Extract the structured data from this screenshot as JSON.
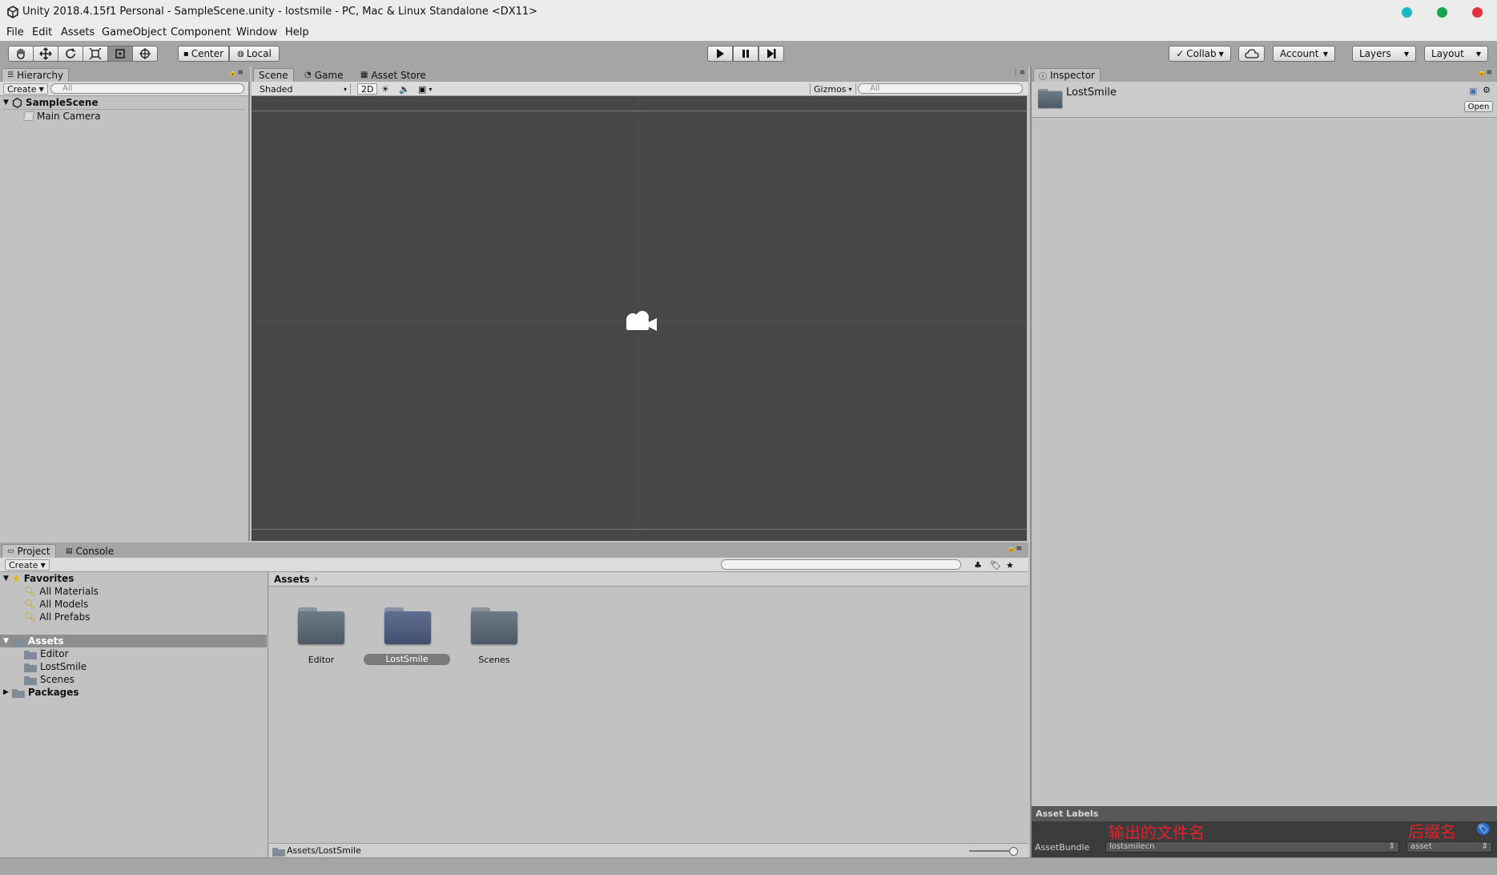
{
  "window": {
    "title": "Unity 2018.4.15f1 Personal - SampleScene.unity - lostsmile - PC, Mac & Linux Standalone <DX11>",
    "dots": [
      "#1ab9c4",
      "#1aa34f",
      "#e0323f"
    ]
  },
  "menu": [
    "File",
    "Edit",
    "Assets",
    "GameObject",
    "Component",
    "Window",
    "Help"
  ],
  "toolbar": {
    "pivot": "Center",
    "space": "Local",
    "collab": "Collab",
    "account": "Account",
    "layers": "Layers",
    "layout": "Layout"
  },
  "hierarchy": {
    "tab": "Hierarchy",
    "create": "Create",
    "search_placeholder": "All",
    "scene": "SampleScene",
    "items": [
      "Main Camera"
    ]
  },
  "scene_view": {
    "tabs": [
      "Scene",
      "Game",
      "Asset Store"
    ],
    "shading": "Shaded",
    "mode_2d": "2D",
    "gizmos": "Gizmos",
    "search_placeholder": "All"
  },
  "inspector": {
    "tab": "Inspector",
    "asset_name": "LostSmile",
    "open_button": "Open",
    "asset_labels": "Asset Labels",
    "asset_bundle_label": "AssetBundle",
    "bundle_name": "lostsmilecn",
    "bundle_variant": "asset",
    "annotation_name": "输出的文件名",
    "annotation_ext": "后缀名"
  },
  "project": {
    "tabs": [
      "Project",
      "Console"
    ],
    "create": "Create",
    "favorites_label": "Favorites",
    "favorites": [
      "All Materials",
      "All Models",
      "All Prefabs"
    ],
    "assets_label": "Assets",
    "asset_folders": [
      "Editor",
      "LostSmile",
      "Scenes"
    ],
    "packages_label": "Packages",
    "breadcrumb": "Assets",
    "grid_items": [
      "Editor",
      "LostSmile",
      "Scenes"
    ],
    "selected": "LostSmile",
    "status_path": "Assets/LostSmile"
  },
  "colors": {
    "scene_bg": "#474747",
    "annotation": "#e0202a",
    "selection": "#7a7a7a"
  }
}
